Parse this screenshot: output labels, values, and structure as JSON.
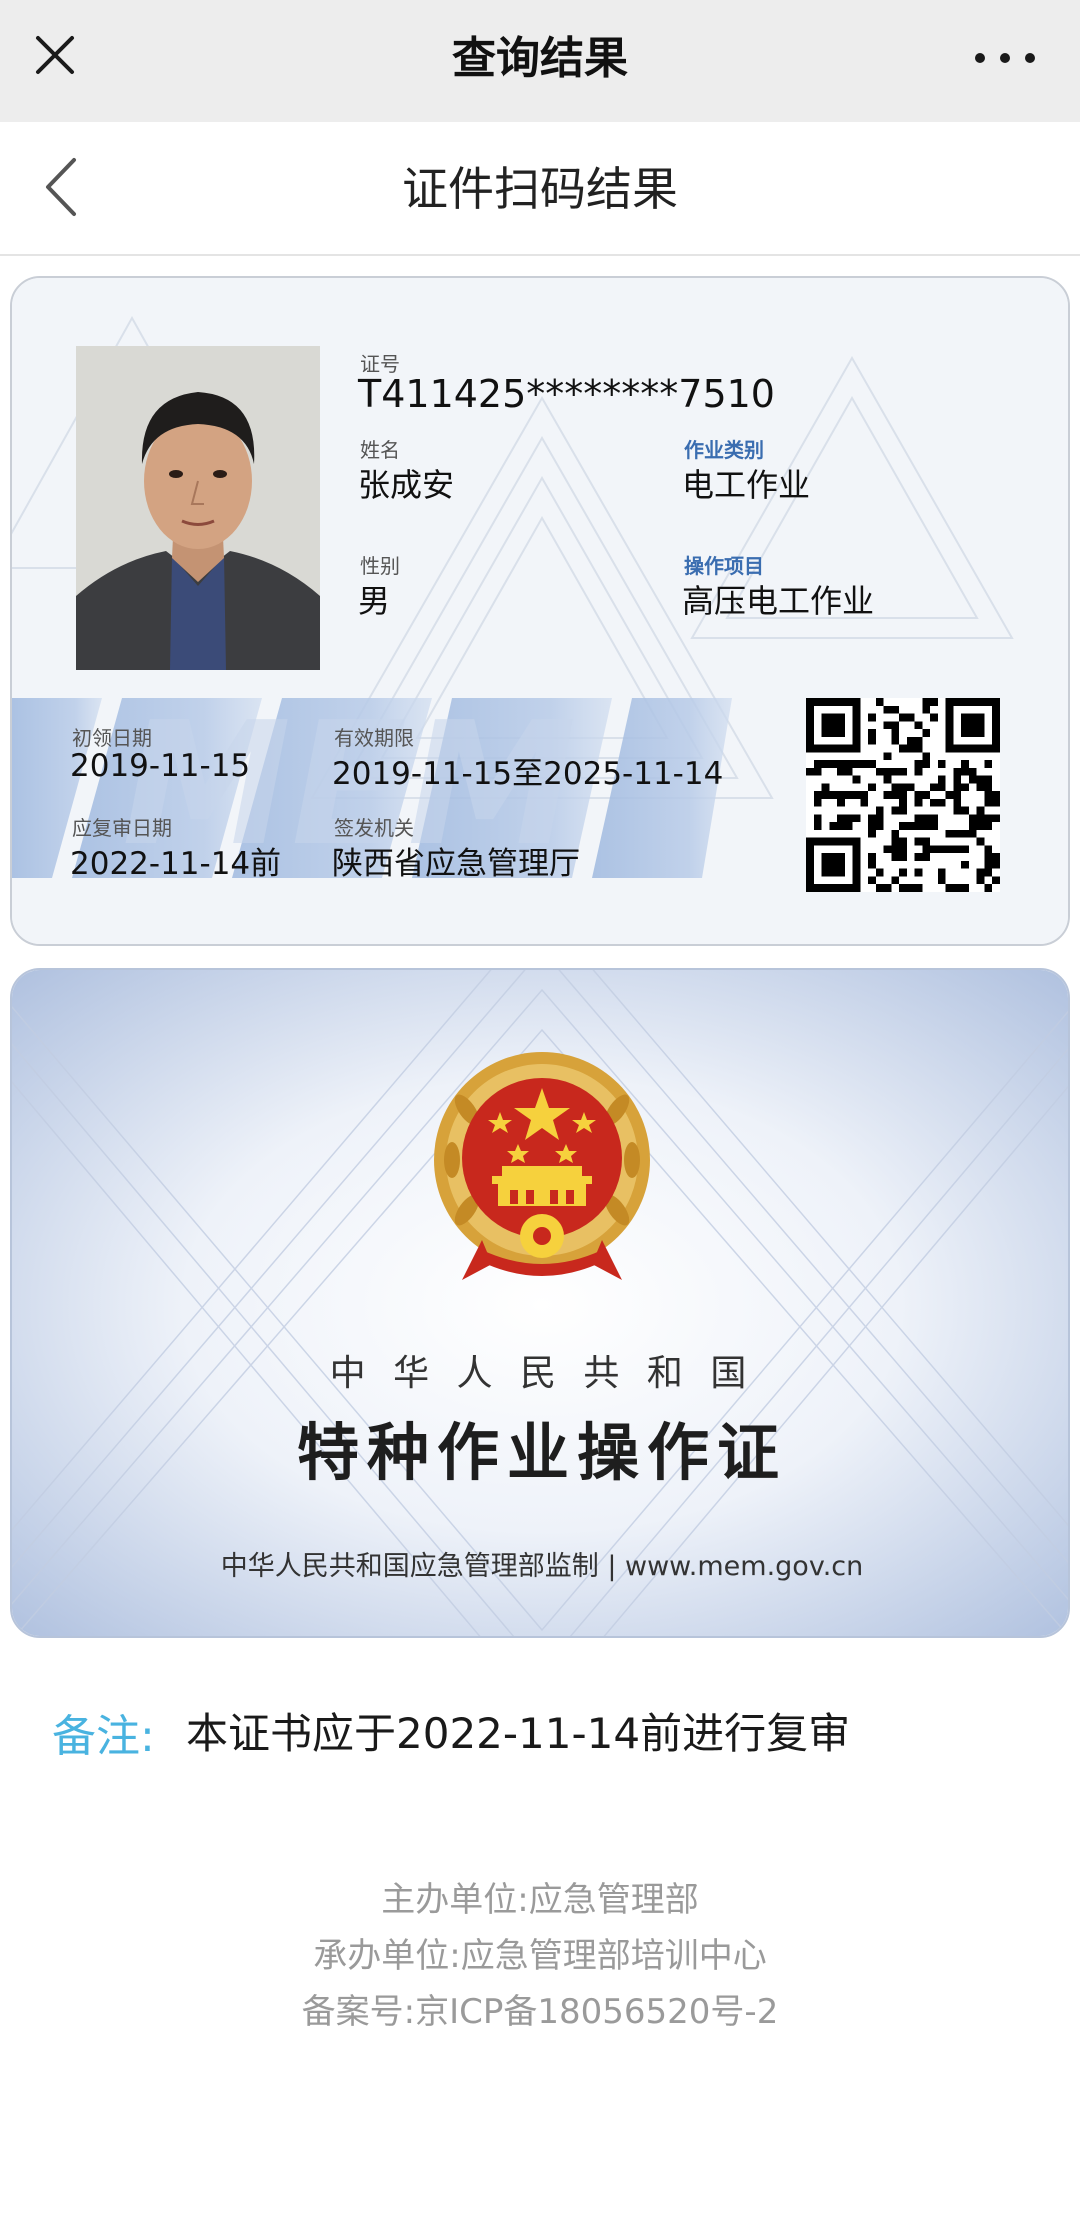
{
  "topbar": {
    "title": "查询结果",
    "close_icon": "close-icon",
    "more_icon": "more-dots-icon"
  },
  "subheader": {
    "title": "证件扫码结果",
    "back_icon": "chevron-left-icon"
  },
  "card_front": {
    "cert_no_label": "证号",
    "cert_no": "T411425********7510",
    "name_label": "姓名",
    "name": "张成安",
    "work_type_label": "作业类别",
    "work_type": "电工作业",
    "gender_label": "性别",
    "gender": "男",
    "item_label": "操作项目",
    "item": "高压电工作业",
    "first_date_label": "初领日期",
    "first_date": "2019-11-15",
    "valid_label": "有效期限",
    "valid": "2019-11-15至2025-11-14",
    "review_label": "应复审日期",
    "review": "2022-11-14前",
    "issuer_label": "签发机关",
    "issuer": "陕西省应急管理厅",
    "emblem_text": "MEM"
  },
  "card_back": {
    "country": "中 华 人 民 共 和 国",
    "cert_title": "特种作业操作证",
    "supervision": "中华人民共和国应急管理部监制 | www.mem.gov.cn"
  },
  "note": {
    "label": "备注:",
    "text": "本证书应于2022-11-14前进行复审"
  },
  "footer": {
    "host": "主办单位:应急管理部",
    "organizer": "承办单位:应急管理部培训中心",
    "icp": "备案号:京ICP备18056520号-2"
  },
  "colors": {
    "topbar_bg": "#ededed",
    "note_label": "#49b3e0",
    "field_label_blue": "#3a6db0",
    "footer_text": "#9a9a9a"
  }
}
